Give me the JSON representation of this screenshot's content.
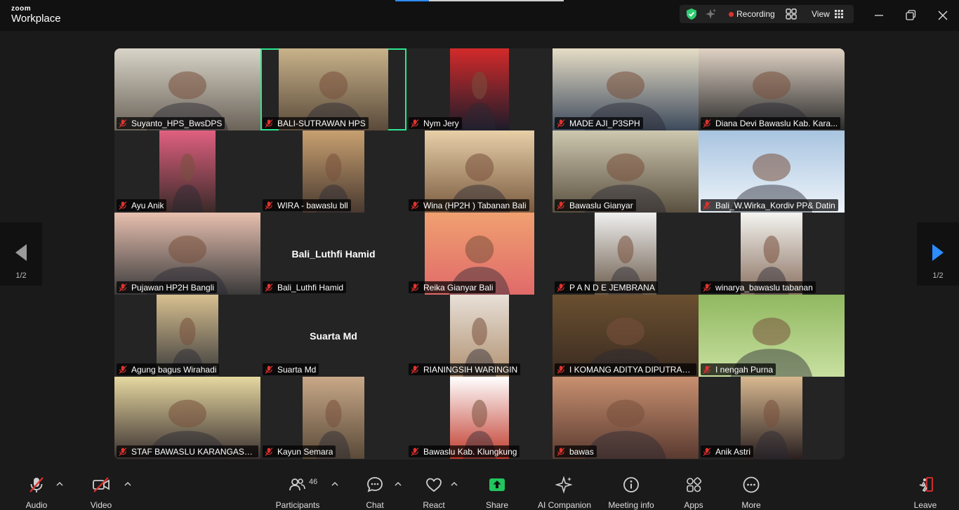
{
  "app": {
    "brand_top": "zoom",
    "brand_bottom": "Workplace"
  },
  "status": {
    "recording_label": "Recording",
    "view_label": "View",
    "recording_color": "#e0322e",
    "security_color": "#2ecc71"
  },
  "pager": {
    "page_label": "1/2"
  },
  "gallery": {
    "active_color": "#2ee58f",
    "tiles": [
      {
        "name": "Suyanto_HPS_BwsDPS",
        "video": true
      },
      {
        "name": "BALI-SUTRAWAN HPS",
        "video": true,
        "active": true
      },
      {
        "name": "Nym Jery",
        "video": true
      },
      {
        "name": "MADE AJI_P3SPH",
        "video": true
      },
      {
        "name": "Diana Devi Bawaslu Kab. Kara...",
        "video": true
      },
      {
        "name": "Ayu Anik",
        "video": true
      },
      {
        "name": "WIRA - bawaslu bll",
        "video": true
      },
      {
        "name": "Wina (HP2H ) Tabanan Bali",
        "video": true
      },
      {
        "name": "Bawaslu Gianyar",
        "video": true
      },
      {
        "name": "Bali_W.Wirka_Kordiv PP& Datin",
        "video": true
      },
      {
        "name": "Pujawan HP2H Bangli",
        "video": true
      },
      {
        "name": "Bali_Luthfi Hamid",
        "video": false,
        "display": "Bali_Luthfi Hamid"
      },
      {
        "name": "Reika Gianyar Bali",
        "video": true
      },
      {
        "name": "P A N D E   JEMBRANA",
        "video": true
      },
      {
        "name": "winarya_bawaslu tabanan",
        "video": true
      },
      {
        "name": "Agung bagus Wirahadi",
        "video": true
      },
      {
        "name": "Suarta Md",
        "video": false,
        "display": "Suarta Md"
      },
      {
        "name": "RIANINGSIH WARINGIN",
        "video": true
      },
      {
        "name": "I KOMANG ADITYA DIPUTRA_...",
        "video": true
      },
      {
        "name": "I nengah Purna",
        "video": true
      },
      {
        "name": "STAF BAWASLU KARANGASE...",
        "video": true
      },
      {
        "name": "Kayun Semara",
        "video": true
      },
      {
        "name": "Bawaslu Kab. Klungkung",
        "video": true
      },
      {
        "name": "bawas",
        "video": true
      },
      {
        "name": "Anik Astri",
        "video": true
      }
    ]
  },
  "toolbar": {
    "audio": "Audio",
    "video": "Video",
    "participants": "Participants",
    "participants_count": "46",
    "chat": "Chat",
    "react": "React",
    "share": "Share",
    "share_color": "#22c55e",
    "ai_companion": "AI Companion",
    "meeting_info": "Meeting info",
    "apps": "Apps",
    "more": "More",
    "leave": "Leave",
    "leave_color": "#e0322e"
  }
}
